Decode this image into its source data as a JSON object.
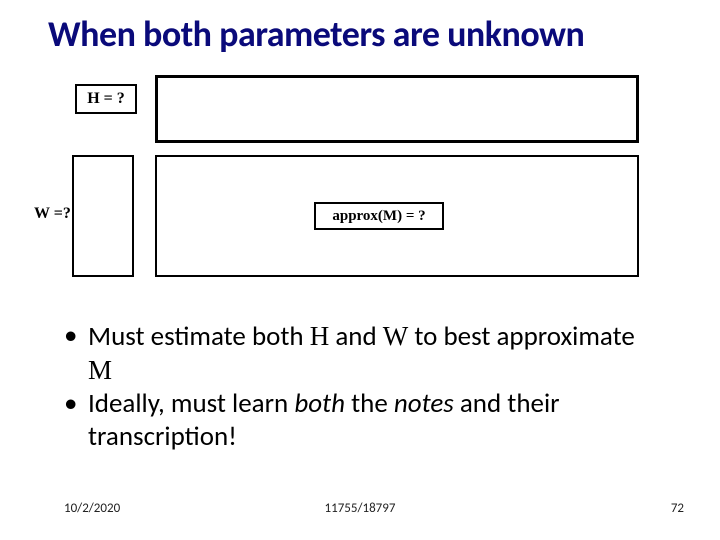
{
  "title": "When both parameters are unknown",
  "labels": {
    "H": "H = ?",
    "W": "W =?",
    "approx": "approx(M) = ?"
  },
  "bullets": [
    {
      "pre": "Must estimate both ",
      "b1": "H",
      "mid1": " and ",
      "b2": "W",
      "mid2": " to best approximate ",
      "b3": "M"
    },
    {
      "pre": "Ideally, must learn ",
      "i1": "both",
      "mid1": " the ",
      "i2": "notes",
      "post": " and their transcription!"
    }
  ],
  "footer": {
    "date": "10/2/2020",
    "course": "11755/18797",
    "page": "72"
  }
}
